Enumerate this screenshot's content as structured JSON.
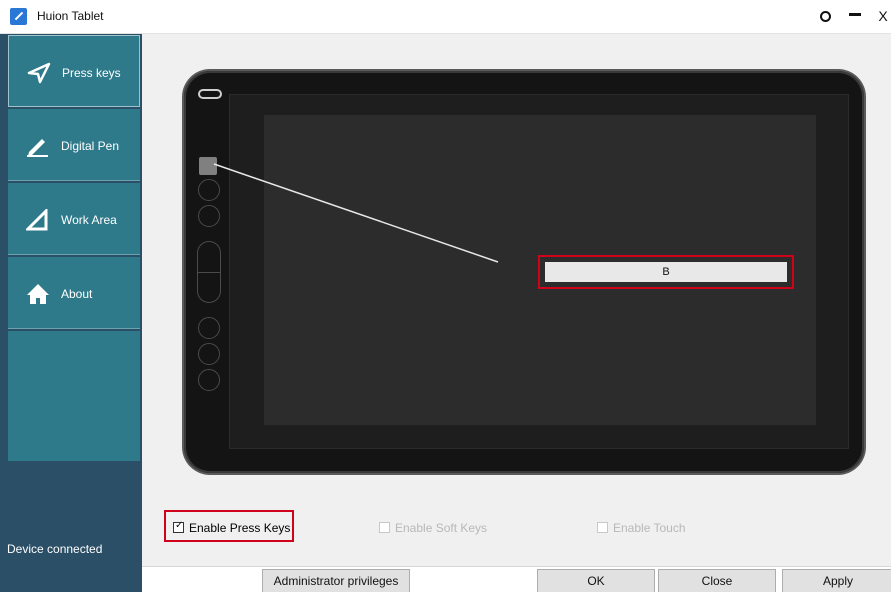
{
  "window": {
    "title": "Huion Tablet",
    "settings_icon": "gear-icon",
    "minimize_glyph": "—",
    "close_glyph": "X"
  },
  "sidebar": {
    "items": [
      {
        "label": "Press keys",
        "icon": "send-arrow-icon"
      },
      {
        "label": "Digital Pen",
        "icon": "pen-icon"
      },
      {
        "label": "Work Area",
        "icon": "triangle-icon"
      },
      {
        "label": "About",
        "icon": "home-icon"
      }
    ],
    "status": "Device connected"
  },
  "tablet": {
    "assigned_key_value": "B"
  },
  "options": {
    "enable_press_keys": {
      "label": "Enable Press Keys",
      "checked": true
    },
    "enable_soft_keys": {
      "label": "Enable Soft Keys",
      "checked": false
    },
    "enable_touch": {
      "label": "Enable Touch",
      "checked": false
    }
  },
  "buttons": {
    "admin": "Administrator privileges",
    "ok": "OK",
    "close": "Close",
    "apply": "Apply"
  },
  "colors": {
    "sidebar_dark": "#2a4f66",
    "sidebar_item": "#2e7a8a",
    "highlight": "#d0021b"
  }
}
